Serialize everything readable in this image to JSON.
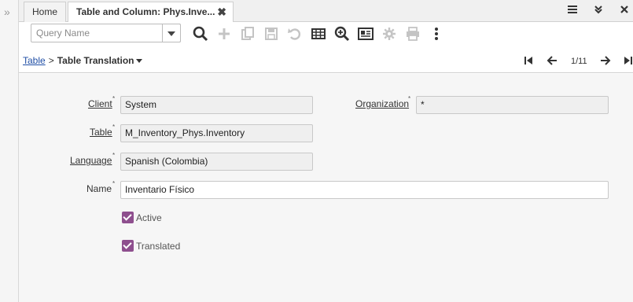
{
  "tabs": [
    {
      "label": "Home"
    },
    {
      "label": "Table and Column: Phys.Inve...",
      "close": "✖"
    }
  ],
  "tabbar_icons": [
    "hamburger-menu-icon",
    "double-chevron-down-icon",
    "close-icon"
  ],
  "toolbar": {
    "query_placeholder": "Query Name",
    "icons": [
      "search-icon",
      "add-icon",
      "copy-icon",
      "save-icon",
      "undo-icon",
      "grid-icon",
      "zoom-icon",
      "report-icon",
      "gear-icon",
      "print-icon",
      "more-icon"
    ]
  },
  "breadcrumb": {
    "parent": "Table",
    "separator": ">",
    "current": "Table Translation"
  },
  "pager": {
    "text": "1/11"
  },
  "form": {
    "client": {
      "label": "Client",
      "value": "System"
    },
    "organization": {
      "label": "Organization",
      "value": "*"
    },
    "table": {
      "label": "Table",
      "value": "M_Inventory_Phys.Inventory"
    },
    "language": {
      "label": "Language",
      "value": "Spanish (Colombia)"
    },
    "name": {
      "label": "Name",
      "value": "Inventario Físico"
    },
    "active": {
      "label": "Active",
      "checked": true
    },
    "translated": {
      "label": "Translated",
      "checked": true
    },
    "required_mark": "*"
  },
  "colors": {
    "accent_checkbox": "#8e4f8e",
    "link": "#1f4ea5"
  }
}
